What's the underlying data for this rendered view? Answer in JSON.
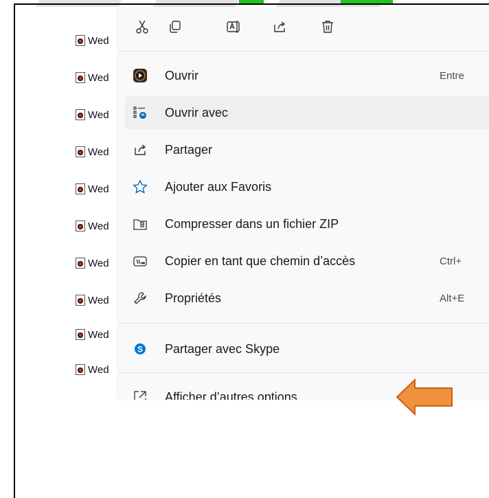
{
  "files": {
    "name_prefix": "Wed",
    "rows": [
      "Wed",
      "Wed",
      "Wed",
      "Wed",
      "Wed",
      "Wed",
      "Wed",
      "Wed",
      "Wed",
      "Wed"
    ]
  },
  "toolbar": {
    "icons": [
      "cut-icon",
      "copy-icon",
      "rename-icon",
      "share-icon",
      "delete-icon"
    ]
  },
  "menu": {
    "items": [
      {
        "label": "Ouvrir",
        "shortcut": "Entre",
        "icon": "media-player-icon"
      },
      {
        "label": "Ouvrir avec",
        "shortcut": "",
        "icon": "open-with-icon"
      },
      {
        "label": "Partager",
        "shortcut": "",
        "icon": "share-icon"
      },
      {
        "label": "Ajouter aux Favoris",
        "shortcut": "",
        "icon": "star-icon"
      },
      {
        "label": "Compresser dans un fichier ZIP",
        "shortcut": "",
        "icon": "zip-folder-icon"
      },
      {
        "label": "Copier en tant que chemin d’accès",
        "shortcut": "Ctrl+",
        "icon": "path-icon"
      },
      {
        "label": "Propriétés",
        "shortcut": "Alt+E",
        "icon": "wrench-icon"
      },
      {
        "label": "Partager avec Skype",
        "shortcut": "",
        "icon": "skype-icon"
      },
      {
        "label": "Afficher d’autres options",
        "shortcut": "",
        "icon": "more-options-icon"
      }
    ]
  },
  "colors": {
    "accent": "#0067c0",
    "arrow": "#f0913c",
    "arrow_border": "#c8601a",
    "highlight_green": "#22c322"
  }
}
